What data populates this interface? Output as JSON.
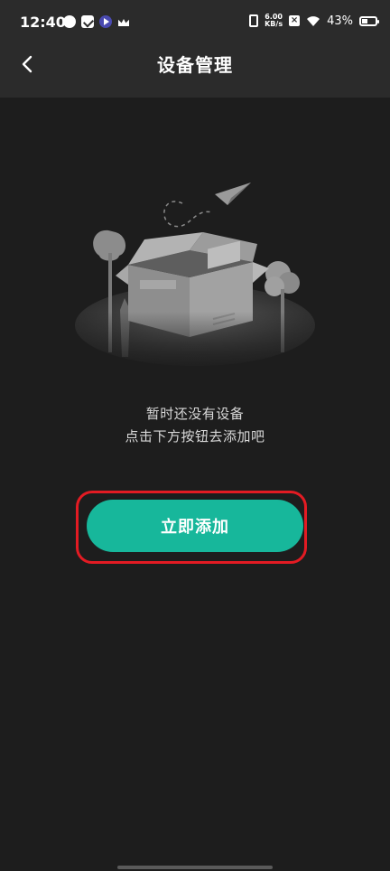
{
  "status_bar": {
    "time": "12:40",
    "net_speed_value": "6.00",
    "net_speed_unit": "KB/s",
    "battery_percent": "43%"
  },
  "header": {
    "title": "设备管理"
  },
  "empty_state": {
    "line1": "暂时还没有设备",
    "line2": "点击下方按钮去添加吧"
  },
  "actions": {
    "add_now": "立即添加"
  },
  "colors": {
    "background": "#1d1d1d",
    "header": "#2b2b2b",
    "accent": "#17b79b",
    "highlight": "#e31b23"
  }
}
